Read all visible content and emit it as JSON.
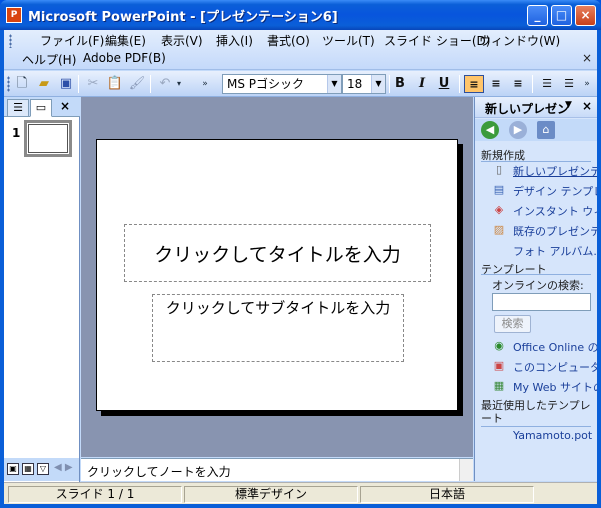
{
  "window": {
    "title": "Microsoft PowerPoint - [プレゼンテーション6]",
    "app_icon": "powerpoint-icon"
  },
  "title_buttons": {
    "minimize": "_",
    "maximize": "□",
    "close": "×"
  },
  "menubar": {
    "items": [
      "ファイル(F)",
      "編集(E)",
      "表示(V)",
      "挿入(I)",
      "書式(O)",
      "ツール(T)",
      "スライド ショー(D)",
      "ウィンドウ(W)",
      "ヘルプ(H)",
      "Adobe PDF(B)"
    ],
    "close_glyph": "×"
  },
  "toolbar": {
    "font_name": "MS Pゴシック",
    "font_size": "18",
    "bold": "B",
    "italic": "I",
    "underline": "U"
  },
  "outline_tabs": {
    "close_glyph": "×"
  },
  "slide_thumbnail": {
    "number": "1"
  },
  "slide": {
    "title_placeholder": "クリックしてタイトルを入力",
    "subtitle_placeholder": "クリックしてサブタイトルを入力"
  },
  "notes": {
    "placeholder": "クリックしてノートを入力"
  },
  "task_pane": {
    "header": "新しいプレゼン",
    "close_glyph": "×",
    "new_section": "新規作成",
    "new_links": [
      "新しいプレゼンテ",
      "デザイン テンプレ",
      "インスタント ウィザ",
      "既存のプレゼンテ",
      "フォト アルバム..."
    ],
    "template_section": "テンプレート",
    "online_search_label": "オンラインの検索:",
    "search_button": "検索",
    "template_links": [
      "Office Online の",
      "このコンピュータ上",
      "My Web サイトの"
    ],
    "recent_section": "最近使用したテンプレート",
    "recent_items": [
      "Yamamoto.pot"
    ]
  },
  "statusbar": {
    "slide": "スライド 1 / 1",
    "design": "標準デザイン",
    "language": "日本語"
  }
}
